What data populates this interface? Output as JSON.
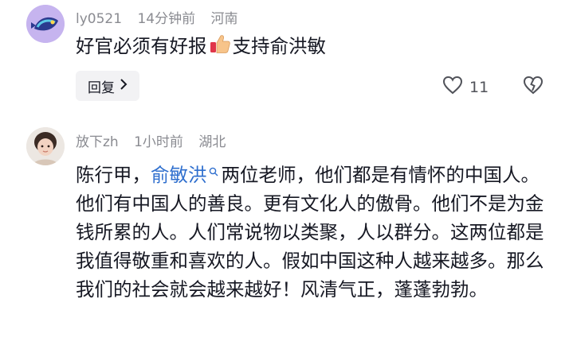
{
  "comments": [
    {
      "username": "ly0521",
      "time": "14分钟前",
      "location": "河南",
      "text_before": "好官必须有好报",
      "emoji": "thumbs-up",
      "text_after": "支持俞洪敏",
      "reply_label": "回复",
      "like_count": "11"
    },
    {
      "username": "放下zh",
      "time": "1小时前",
      "location": "湖北",
      "text_before": "陈行甲，",
      "mention": "俞敏洪",
      "text_after": "两位老师，他们都是有情怀的中国人。他们有中国人的善良。更有文化人的傲骨。他们不是为金钱所累的人。人们常说物以类聚，人以群分。这两位都是我值得敬重和喜欢的人。假如中国这种人越来越多。那么我们的社会就会越来越好！风清气正，蓬蓬勃勃。"
    }
  ],
  "colors": {
    "text": "#161823",
    "meta": "#8a8b91",
    "mention": "#2f6fce",
    "reply_bg": "#f2f2f4"
  }
}
